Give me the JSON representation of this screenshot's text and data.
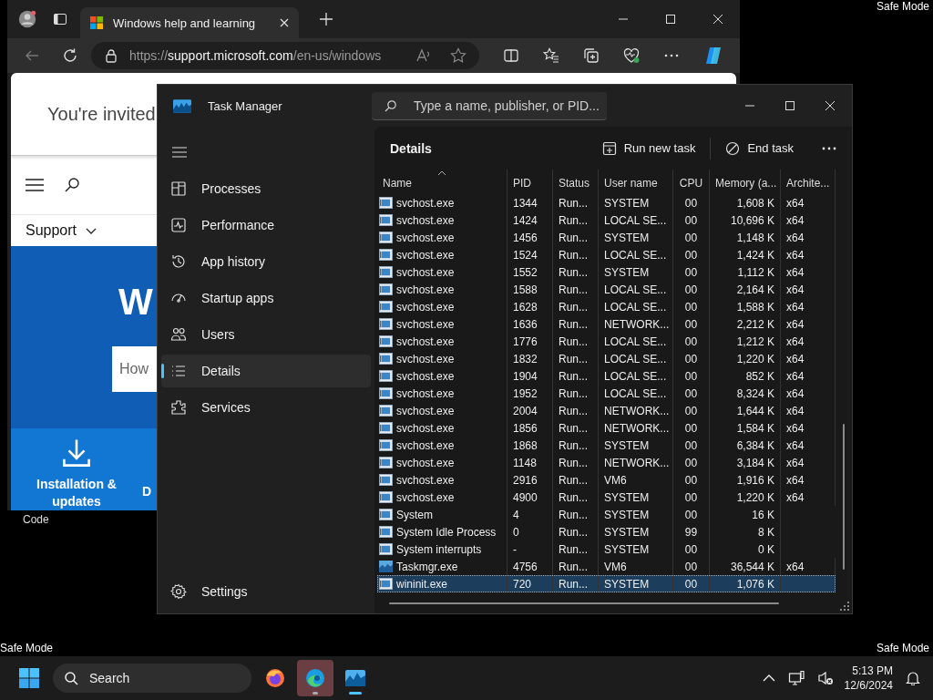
{
  "desktop": {
    "safe_mode_labels": [
      "Safe Mode",
      "Safe Mode",
      "Safe Mode"
    ],
    "icon_label": "Code"
  },
  "browser": {
    "tab_title": "Windows help and learning",
    "url": {
      "scheme": "https://",
      "host": "support.microsoft.com",
      "path": "/en-us/windows"
    },
    "page": {
      "banner": "You're invited",
      "menu_label": "Support",
      "hero_heading": "W",
      "search_placeholder": "How",
      "tiles": [
        {
          "label": "Installation & updates",
          "kind": "download"
        },
        {
          "label": "D",
          "kind": "text"
        }
      ]
    }
  },
  "task_manager": {
    "title": "Task Manager",
    "search_placeholder": "Type a name, publisher, or PID...",
    "nav": [
      {
        "label": "Processes",
        "kind": "processes",
        "selected": false
      },
      {
        "label": "Performance",
        "kind": "performance",
        "selected": false
      },
      {
        "label": "App history",
        "kind": "history",
        "selected": false
      },
      {
        "label": "Startup apps",
        "kind": "startup",
        "selected": false
      },
      {
        "label": "Users",
        "kind": "users",
        "selected": false
      },
      {
        "label": "Details",
        "kind": "details",
        "selected": true
      },
      {
        "label": "Services",
        "kind": "services",
        "selected": false
      }
    ],
    "settings": "Settings",
    "page_title": "Details",
    "actions": [
      {
        "label": "Run new task",
        "kind": "run"
      },
      {
        "label": "End task",
        "kind": "end"
      }
    ],
    "table": {
      "columns": [
        {
          "label": "Name",
          "sorted": true
        },
        {
          "label": "PID",
          "sorted": false
        },
        {
          "label": "Status",
          "sorted": false
        },
        {
          "label": "User name",
          "sorted": false
        },
        {
          "label": "CPU",
          "sorted": false
        },
        {
          "label": "Memory (a...",
          "sorted": false
        },
        {
          "label": "Archite...",
          "sorted": false
        }
      ],
      "rows": [
        {
          "kind": "service",
          "cells": [
            "svchost.exe",
            "1344",
            "Run...",
            "SYSTEM",
            "00",
            "1,608 K",
            "x64"
          ],
          "selected": false
        },
        {
          "kind": "service",
          "cells": [
            "svchost.exe",
            "1424",
            "Run...",
            "LOCAL SE...",
            "00",
            "10,696 K",
            "x64"
          ],
          "selected": false
        },
        {
          "kind": "service",
          "cells": [
            "svchost.exe",
            "1456",
            "Run...",
            "SYSTEM",
            "00",
            "1,148 K",
            "x64"
          ],
          "selected": false
        },
        {
          "kind": "service",
          "cells": [
            "svchost.exe",
            "1524",
            "Run...",
            "LOCAL SE...",
            "00",
            "1,424 K",
            "x64"
          ],
          "selected": false
        },
        {
          "kind": "service",
          "cells": [
            "svchost.exe",
            "1552",
            "Run...",
            "SYSTEM",
            "00",
            "1,112 K",
            "x64"
          ],
          "selected": false
        },
        {
          "kind": "service",
          "cells": [
            "svchost.exe",
            "1588",
            "Run...",
            "LOCAL SE...",
            "00",
            "2,164 K",
            "x64"
          ],
          "selected": false
        },
        {
          "kind": "service",
          "cells": [
            "svchost.exe",
            "1628",
            "Run...",
            "LOCAL SE...",
            "00",
            "1,588 K",
            "x64"
          ],
          "selected": false
        },
        {
          "kind": "service",
          "cells": [
            "svchost.exe",
            "1636",
            "Run...",
            "NETWORK...",
            "00",
            "2,212 K",
            "x64"
          ],
          "selected": false
        },
        {
          "kind": "service",
          "cells": [
            "svchost.exe",
            "1776",
            "Run...",
            "LOCAL SE...",
            "00",
            "1,212 K",
            "x64"
          ],
          "selected": false
        },
        {
          "kind": "service",
          "cells": [
            "svchost.exe",
            "1832",
            "Run...",
            "LOCAL SE...",
            "00",
            "1,220 K",
            "x64"
          ],
          "selected": false
        },
        {
          "kind": "service",
          "cells": [
            "svchost.exe",
            "1904",
            "Run...",
            "LOCAL SE...",
            "00",
            "852 K",
            "x64"
          ],
          "selected": false
        },
        {
          "kind": "service",
          "cells": [
            "svchost.exe",
            "1952",
            "Run...",
            "LOCAL SE...",
            "00",
            "8,324 K",
            "x64"
          ],
          "selected": false
        },
        {
          "kind": "service",
          "cells": [
            "svchost.exe",
            "2004",
            "Run...",
            "NETWORK...",
            "00",
            "1,644 K",
            "x64"
          ],
          "selected": false
        },
        {
          "kind": "service",
          "cells": [
            "svchost.exe",
            "1856",
            "Run...",
            "NETWORK...",
            "00",
            "1,584 K",
            "x64"
          ],
          "selected": false
        },
        {
          "kind": "service",
          "cells": [
            "svchost.exe",
            "1868",
            "Run...",
            "SYSTEM",
            "00",
            "6,384 K",
            "x64"
          ],
          "selected": false
        },
        {
          "kind": "service",
          "cells": [
            "svchost.exe",
            "1148",
            "Run...",
            "NETWORK...",
            "00",
            "3,184 K",
            "x64"
          ],
          "selected": false
        },
        {
          "kind": "service",
          "cells": [
            "svchost.exe",
            "2916",
            "Run...",
            "VM6",
            "00",
            "1,916 K",
            "x64"
          ],
          "selected": false
        },
        {
          "kind": "service",
          "cells": [
            "svchost.exe",
            "4900",
            "Run...",
            "SYSTEM",
            "00",
            "1,220 K",
            "x64"
          ],
          "selected": false
        },
        {
          "kind": "service",
          "cells": [
            "System",
            "4",
            "Run...",
            "SYSTEM",
            "00",
            "16 K"
          ],
          "selected": false
        },
        {
          "kind": "service",
          "cells": [
            "System Idle Process",
            "0",
            "Run...",
            "SYSTEM",
            "99",
            "8 K"
          ],
          "selected": false
        },
        {
          "kind": "service",
          "cells": [
            "System interrupts",
            "-",
            "Run...",
            "SYSTEM",
            "00",
            "0 K"
          ],
          "selected": false
        },
        {
          "kind": "taskmgr",
          "cells": [
            "Taskmgr.exe",
            "4756",
            "Run...",
            "VM6",
            "00",
            "36,544 K",
            "x64"
          ],
          "selected": false
        },
        {
          "kind": "service",
          "cells": [
            "wininit.exe",
            "720",
            "Run...",
            "SYSTEM",
            "00",
            "1,076 K"
          ],
          "selected": true
        }
      ]
    }
  },
  "taskbar": {
    "search_placeholder": "Search",
    "apps": [
      {
        "kind": "firefox",
        "selected": false,
        "running": false
      },
      {
        "kind": "edge",
        "selected": true,
        "running": true
      },
      {
        "kind": "taskmgr",
        "selected": false,
        "running": true
      }
    ],
    "time": "5:13 PM",
    "date": "12/6/2024"
  }
}
